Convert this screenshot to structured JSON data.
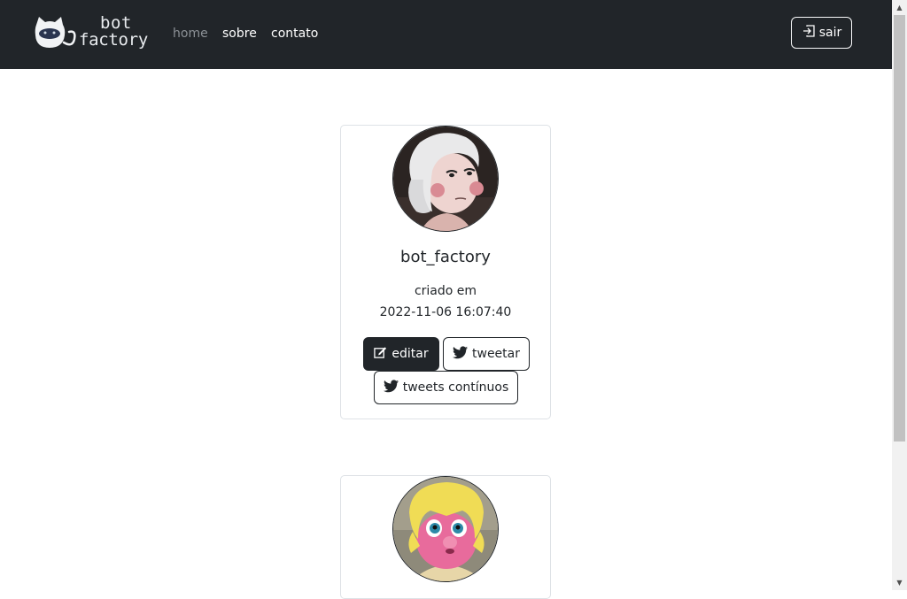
{
  "navbar": {
    "brand": {
      "line1": "bot",
      "line2": "factory",
      "icon": "cat-logo-icon"
    },
    "links": [
      {
        "label": "home",
        "active": true
      },
      {
        "label": "sobre",
        "active": false
      },
      {
        "label": "contato",
        "active": false
      }
    ],
    "logout": {
      "label": "sair",
      "icon": "sign-in-icon"
    }
  },
  "bots": [
    {
      "name": "bot_factory",
      "created_label": "criado em",
      "created_at": "2022-11-06 16:07:40",
      "actions": {
        "edit": {
          "label": "editar",
          "icon": "edit-icon"
        },
        "tweet": {
          "label": "tweetar",
          "icon": "twitter-icon"
        },
        "continuous": {
          "label": "tweets contínuos",
          "icon": "twitter-icon"
        }
      }
    },
    {
      "name": "",
      "avatar": "pink-creature-avatar"
    }
  ],
  "colors": {
    "navbar_bg": "#212529",
    "muted_link": "#8c9196",
    "card_border": "#dee2e6"
  }
}
